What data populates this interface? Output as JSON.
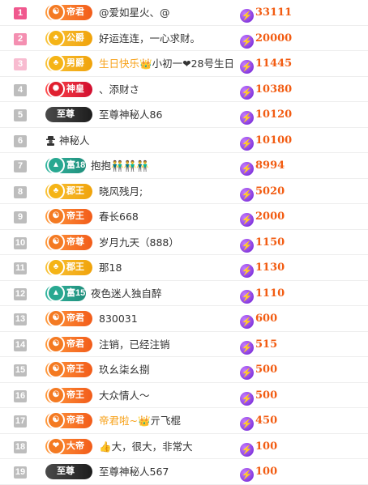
{
  "rows": [
    {
      "rank": "1",
      "badge": "帝君",
      "name": "@爱如星火、@",
      "score": "33111"
    },
    {
      "rank": "2",
      "badge": "公爵",
      "name": "好运连连，一心求财。",
      "score": "20000"
    },
    {
      "rank": "3",
      "badge": "男爵",
      "name_hl": "生日快乐",
      "name_rest": "小初一❤28号生日",
      "score": "11445"
    },
    {
      "rank": "4",
      "badge": "神皇",
      "name": "、添财さ",
      "score": "10380"
    },
    {
      "rank": "5",
      "badge": "至尊",
      "name": "至尊神秘人86",
      "score": "10120"
    },
    {
      "rank": "6",
      "name": "神秘人",
      "score": "10100"
    },
    {
      "rank": "7",
      "badge": "富18",
      "name": "抱抱👬👬👬",
      "score": "8994"
    },
    {
      "rank": "8",
      "badge": "郡王",
      "name": "晓风残月;",
      "score": "5020"
    },
    {
      "rank": "9",
      "badge": "帝王",
      "name": "春长668",
      "score": "2000"
    },
    {
      "rank": "10",
      "badge": "帝尊",
      "name": "岁月九天（888）",
      "score": "1150"
    },
    {
      "rank": "11",
      "badge": "郡王",
      "name": "那18",
      "score": "1130"
    },
    {
      "rank": "12",
      "badge": "富15",
      "name": "夜色迷人独自醉",
      "score": "1110"
    },
    {
      "rank": "13",
      "badge": "帝君",
      "name": "830031",
      "score": "600"
    },
    {
      "rank": "14",
      "badge": "帝君",
      "name": "注销，已经注销",
      "score": "515"
    },
    {
      "rank": "15",
      "badge": "帝王",
      "name": "玖幺柒幺捌",
      "score": "500"
    },
    {
      "rank": "16",
      "badge": "帝王",
      "name": "大众情人～",
      "score": "500"
    },
    {
      "rank": "17",
      "badge": "帝君",
      "name_hl": "帝君啦~",
      "name_rest": "👑亓飞棍",
      "score": "450"
    },
    {
      "rank": "18",
      "badge": "大帝",
      "name": "👍大，很大，非常大",
      "score": "100"
    },
    {
      "rank": "19",
      "badge": "至尊",
      "name": "至尊神秘人567",
      "score": "100"
    }
  ],
  "colors": {
    "score": "#f25c12",
    "rank_top": "#f0588e",
    "name_highlight": "#f7a21a"
  },
  "icons": {
    "score": "lightning-coin-icon",
    "mystery": "spy-icon",
    "crown": "crown-icon"
  }
}
